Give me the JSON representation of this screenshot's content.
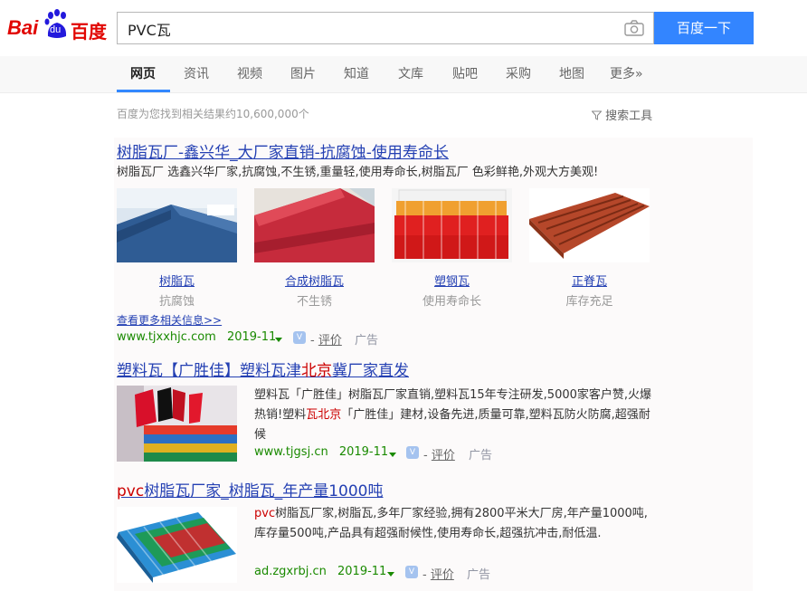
{
  "logo": {
    "text_left": "Bai",
    "text_paw": "du",
    "text_right": "百度"
  },
  "search": {
    "query": "PVC瓦",
    "button_label": "百度一下"
  },
  "tabs": [
    {
      "label": "网页",
      "active": true
    },
    {
      "label": "资讯"
    },
    {
      "label": "视频"
    },
    {
      "label": "图片"
    },
    {
      "label": "知道"
    },
    {
      "label": "文库"
    },
    {
      "label": "贴吧"
    },
    {
      "label": "采购"
    },
    {
      "label": "地图"
    },
    {
      "label": "更多»"
    }
  ],
  "stats": "百度为您找到相关结果约10,600,000个",
  "search_tools": "搜索工具",
  "results": [
    {
      "title": "树脂瓦厂-鑫兴华_大厂家直销-抗腐蚀-使用寿命长",
      "desc": "树脂瓦厂 选鑫兴华厂家,抗腐蚀,不生锈,重量轻,使用寿命长,树脂瓦厂 色彩鲜艳,外观大方美观!",
      "images": [
        {
          "caption": "树脂瓦",
          "sub": "抗腐蚀"
        },
        {
          "caption": "合成树脂瓦",
          "sub": "不生锈"
        },
        {
          "caption": "塑钢瓦",
          "sub": "使用寿命长"
        },
        {
          "caption": "正脊瓦",
          "sub": "库存充足"
        }
      ],
      "more": "查看更多相关信息>>",
      "url": "www.tjxxhjc.com",
      "date": "2019-11",
      "eval": "评价",
      "ad": "广告"
    },
    {
      "title_a": "塑料瓦【广胜佳】塑料瓦津",
      "title_red": "北京",
      "title_b": "冀厂家直发",
      "desc_a": "塑料瓦「广胜佳」树脂瓦厂家直销,塑料瓦15年专注研发,5000家客户赞,火爆热销!塑料",
      "desc_red": "瓦北京",
      "desc_b": "「广胜佳」建材,设备先进,质量可靠,塑料瓦防火防腐,超强耐候",
      "url": "www.tjgsj.cn",
      "date": "2019-11",
      "eval": "评价",
      "ad": "广告"
    },
    {
      "title_red": "pvc",
      "title_b": "树脂瓦厂家_树脂瓦_年产量1000吨",
      "desc_red": "pvc",
      "desc_b": "树脂瓦厂家,树脂瓦,多年厂家经验,拥有2800平米大厂房,年产量1000吨,库存量500吨,产品具有超强耐候性,使用寿命长,超强抗冲击,耐低温.",
      "url": "ad.zgxrbj.cn",
      "date": "2019-11",
      "eval": "评价",
      "ad": "广告"
    }
  ],
  "colors": {
    "accent": "#3385ff",
    "link": "#2440b3",
    "url_green": "#1a8a00",
    "highlight_red": "#cc0000"
  }
}
